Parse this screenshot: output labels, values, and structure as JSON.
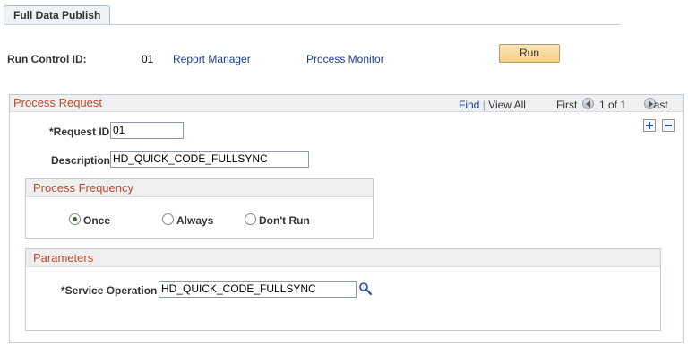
{
  "tab": {
    "label": "Full Data Publish"
  },
  "header": {
    "run_control_label": "Run Control ID:",
    "run_control_value": "01",
    "report_manager": "Report Manager",
    "process_monitor": "Process Monitor",
    "run_button": "Run"
  },
  "process_request": {
    "title": "Process Request",
    "nav": {
      "find": "Find",
      "view_all": "View All",
      "first": "First",
      "range": "1 of 1",
      "last": "Last"
    },
    "request_id_label": "*Request ID",
    "request_id_value": "01",
    "description_label": "Description",
    "description_value": "HD_QUICK_CODE_FULLSYNC",
    "add_icon": "plus-icon",
    "delete_icon": "minus-icon"
  },
  "frequency": {
    "title": "Process Frequency",
    "options": [
      "Once",
      "Always",
      "Don't Run"
    ],
    "selected": "Once"
  },
  "parameters": {
    "title": "Parameters",
    "service_operation_label": "*Service Operation",
    "service_operation_value": "HD_QUICK_CODE_FULLSYNC",
    "lookup_icon": "magnifier-icon"
  }
}
